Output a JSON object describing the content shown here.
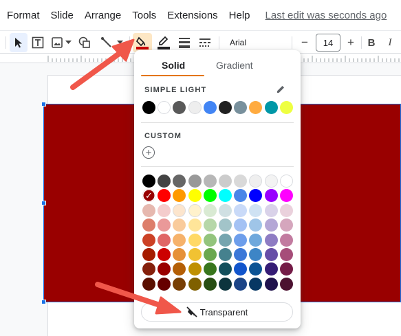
{
  "menubar": {
    "items": [
      "Format",
      "Slide",
      "Arrange",
      "Tools",
      "Extensions",
      "Help"
    ],
    "last_edit": "Last edit was seconds ago"
  },
  "toolbar": {
    "font_name": "Arial",
    "font_size": "14",
    "minus_label": "−",
    "plus_label": "+",
    "bold_label": "B",
    "italic_label": "I",
    "fill_color": "#cc0000"
  },
  "fill_popup": {
    "tabs": [
      "Solid",
      "Gradient"
    ],
    "active_tab": "Solid",
    "simple_light_label": "SIMPLE LIGHT",
    "custom_label": "CUSTOM",
    "transparent_label": "Transparent",
    "theme_colors": [
      "#000000",
      "#ffffff",
      "#595959",
      "#eeeeee",
      "#4285f4",
      "#212121",
      "#78909c",
      "#ffab40",
      "#0097a7",
      "#eeff41"
    ],
    "palette": [
      [
        "#000000",
        "#434343",
        "#666666",
        "#999999",
        "#b7b7b7",
        "#cccccc",
        "#d9d9d9",
        "#efefef",
        "#f3f3f3",
        "#ffffff"
      ],
      [
        "#980000",
        "#ff0000",
        "#ff9900",
        "#ffff00",
        "#00ff00",
        "#00ffff",
        "#4a86e8",
        "#0000ff",
        "#9900ff",
        "#ff00ff"
      ],
      [
        "#e6b8af",
        "#f4cccc",
        "#fce5cd",
        "#fff2cc",
        "#d9ead3",
        "#d0e0e3",
        "#c9daf8",
        "#cfe2f3",
        "#d9d2e9",
        "#ead1dc"
      ],
      [
        "#dd7e6b",
        "#ea9999",
        "#f9cb9c",
        "#ffe599",
        "#b6d7a8",
        "#a2c4c9",
        "#a4c2f4",
        "#9fc5e8",
        "#b4a7d6",
        "#d5a6bd"
      ],
      [
        "#cc4125",
        "#e06666",
        "#f6b26b",
        "#ffd966",
        "#93c47d",
        "#76a5af",
        "#6d9eeb",
        "#6fa8dc",
        "#8e7cc3",
        "#c27ba0"
      ],
      [
        "#a61c00",
        "#cc0000",
        "#e69138",
        "#f1c232",
        "#6aa84f",
        "#45818e",
        "#3c78d8",
        "#3d85c6",
        "#674ea7",
        "#a64d79"
      ],
      [
        "#85200c",
        "#990000",
        "#b45f06",
        "#bf9000",
        "#38761d",
        "#134f5c",
        "#1155cc",
        "#0b5394",
        "#351c75",
        "#741b47"
      ],
      [
        "#5b0f00",
        "#660000",
        "#783f04",
        "#7f6000",
        "#274e13",
        "#0c343d",
        "#1c4587",
        "#073763",
        "#20124d",
        "#4c1130"
      ]
    ],
    "selected": "#980000"
  },
  "colors": {
    "shape_fill": "#990000",
    "selection": "#1a73e8",
    "annotation_arrow": "#f0574a",
    "tab_accent": "#e37400"
  },
  "icons": [
    "select-cursor-icon",
    "text-box-icon",
    "image-icon",
    "shape-icon",
    "line-icon",
    "fill-color-icon",
    "border-color-icon",
    "border-weight-icon",
    "border-dash-icon",
    "edit-pencil-icon",
    "add-circle-icon",
    "transparent-icon",
    "check-icon"
  ]
}
